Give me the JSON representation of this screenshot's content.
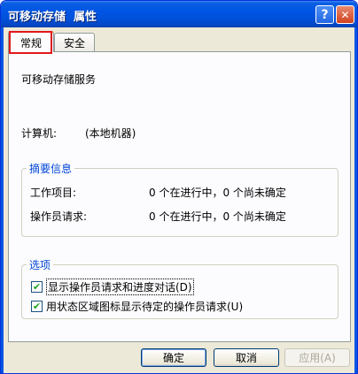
{
  "window": {
    "title": "可移动存储  属性",
    "help_glyph": "?",
    "close_glyph": "✕"
  },
  "tabs": [
    {
      "label": "常规",
      "selected": true
    },
    {
      "label": "安全",
      "selected": false
    }
  ],
  "general": {
    "service_name": "可移动存储服务",
    "computer_label": "计算机:",
    "computer_value": "(本地机器)"
  },
  "summary": {
    "title": "摘要信息",
    "rows": [
      {
        "label": "工作项目:",
        "value": "0 个在进行中，0 个尚未确定"
      },
      {
        "label": "操作员请求:",
        "value": "0 个在进行中，0 个尚未确定"
      }
    ]
  },
  "options": {
    "title": "选项",
    "items": [
      {
        "label": "显示操作员请求和进度对话(D)",
        "checked": true,
        "focused": true
      },
      {
        "label": "用状态区域图标显示待定的操作员请求(U)",
        "checked": true,
        "focused": false
      }
    ],
    "check_glyph": "✔"
  },
  "buttons": {
    "ok": "确定",
    "cancel": "取消",
    "apply": "应用(A)"
  },
  "colors": {
    "titlebar": "#0055e5",
    "group_title": "#0046d5",
    "tab_highlight": "#e0191c",
    "checkmark": "#21a121"
  }
}
